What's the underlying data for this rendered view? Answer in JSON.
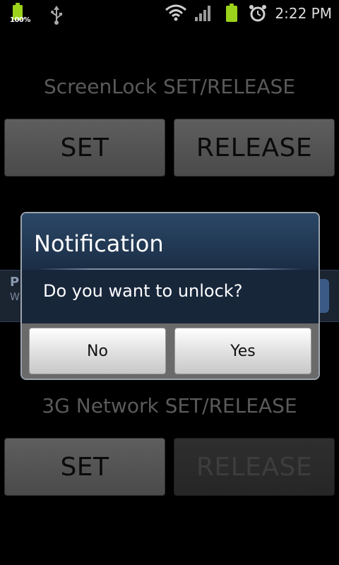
{
  "status_bar": {
    "battery_percent_label": "100%",
    "time": "2:22 PM",
    "icons": [
      "battery-icon",
      "usb-icon",
      "wifi-icon",
      "signal-icon",
      "battery-icon",
      "alarm-icon"
    ],
    "battery_color": "#9bd21b"
  },
  "screenlock": {
    "title": "ScreenLock SET/RELEASE",
    "set_label": "SET",
    "release_label": "RELEASE"
  },
  "background_strip": {
    "title_fragment": "P",
    "subtitle_fragment": "W"
  },
  "dialog": {
    "title": "Notification",
    "message": "Do you want to unlock?",
    "no_label": "No",
    "yes_label": "Yes"
  },
  "network": {
    "title": "3G Network SET/RELEASE",
    "set_label": "SET",
    "release_label": "RELEASE",
    "release_enabled": false
  },
  "colors": {
    "background": "#000000",
    "dialog_background": "#18263a",
    "button_gray": "#555555"
  }
}
